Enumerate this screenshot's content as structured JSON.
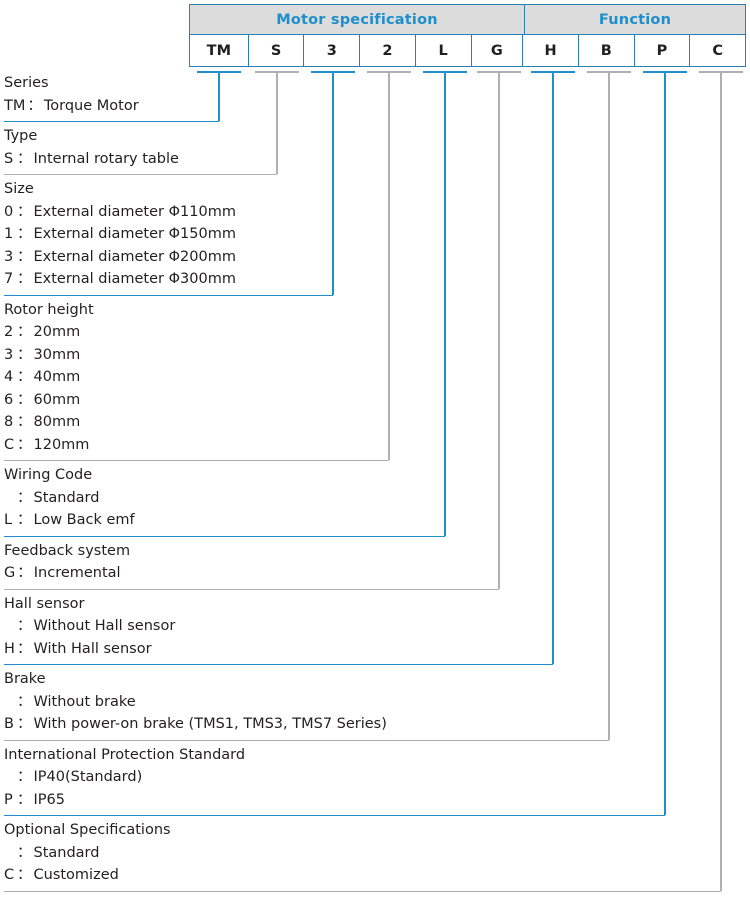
{
  "table": {
    "groups": [
      {
        "label": "Motor specification",
        "span": 6
      },
      {
        "label": "Function",
        "span": 5
      }
    ],
    "codes": [
      "TM",
      "S",
      "3",
      "2",
      "L",
      "G",
      "H",
      "B",
      "P",
      "C"
    ],
    "accent_color": "#1f8fcb",
    "border_color": "#2a7fb5",
    "group_bg": "#dcdcdc"
  },
  "sections": [
    {
      "title": "Series",
      "entries": [
        {
          "code": "TM",
          "desc": "Torque Motor"
        }
      ]
    },
    {
      "title": "Type",
      "entries": [
        {
          "code": "S",
          "desc": "Internal rotary table"
        }
      ]
    },
    {
      "title": "Size",
      "entries": [
        {
          "code": "0",
          "desc": "External diameter Φ110mm"
        },
        {
          "code": "1",
          "desc": "External diameter Φ150mm"
        },
        {
          "code": "3",
          "desc": "External diameter Φ200mm"
        },
        {
          "code": "7",
          "desc": "External diameter Φ300mm"
        }
      ]
    },
    {
      "title": "Rotor height",
      "entries": [
        {
          "code": "2",
          "desc": "20mm"
        },
        {
          "code": "3",
          "desc": "30mm"
        },
        {
          "code": "4",
          "desc": "40mm"
        },
        {
          "code": "6",
          "desc": "60mm"
        },
        {
          "code": "8",
          "desc": "80mm"
        },
        {
          "code": "C",
          "desc": "120mm"
        }
      ]
    },
    {
      "title": "Wiring Code",
      "entries": [
        {
          "code": "",
          "desc": "Standard"
        },
        {
          "code": "L",
          "desc": "Low Back emf"
        }
      ]
    },
    {
      "title": "Feedback system",
      "entries": [
        {
          "code": "G",
          "desc": "Incremental"
        }
      ]
    },
    {
      "title": "Hall sensor",
      "entries": [
        {
          "code": "",
          "desc": "Without Hall sensor"
        },
        {
          "code": "H",
          "desc": "With Hall sensor"
        }
      ]
    },
    {
      "title": "Brake",
      "entries": [
        {
          "code": "",
          "desc": "Without brake"
        },
        {
          "code": "B",
          "desc": "With power-on brake (TMS1, TMS3, TMS7 Series)"
        }
      ]
    },
    {
      "title": "International Protection Standard",
      "entries": [
        {
          "code": "",
          "desc": "IP40(Standard)"
        },
        {
          "code": "P",
          "desc": "IP65"
        }
      ]
    },
    {
      "title": "Optional Specifications",
      "entries": [
        {
          "code": "",
          "desc": "Standard"
        },
        {
          "code": "C",
          "desc": "Customized"
        }
      ]
    }
  ],
  "colon": "："
}
